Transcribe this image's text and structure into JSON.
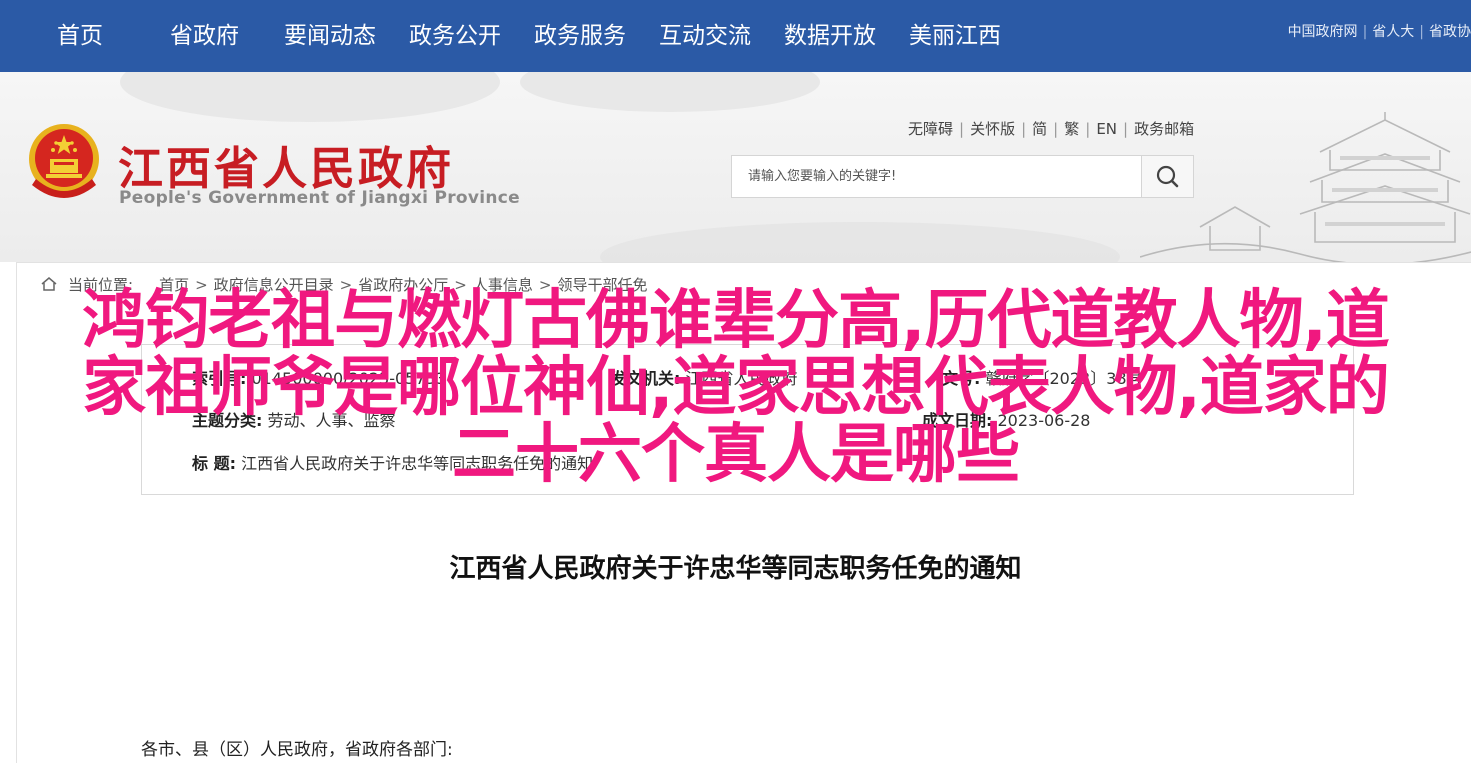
{
  "nav": {
    "items": [
      "首页",
      "省政府",
      "要闻动态",
      "政务公开",
      "政务服务",
      "互动交流",
      "数据开放",
      "美丽江西"
    ],
    "top_links": [
      "中国政府网",
      "省人大",
      "省政协"
    ]
  },
  "header": {
    "site_title": "江西省人民政府",
    "site_subtitle": "People's Government of Jiangxi Province",
    "utility_links": [
      "无障碍",
      "关怀版",
      "简",
      "繁",
      "EN",
      "政务邮箱"
    ],
    "search_placeholder": "请输入您要输入的关键字!"
  },
  "breadcrumb": {
    "label": "当前位置:",
    "items": [
      "首页",
      "政府信息公开目录",
      "省政府办公厅",
      "人事信息",
      "领导干部任免"
    ]
  },
  "info": {
    "index_label": "索引号:",
    "index_value": "014500000/2023-05733",
    "issuer_label": "发文机关:",
    "issuer_value": "江西省人民政府",
    "doc_no_label": "文号:",
    "doc_no_value": "赣府字〔2023〕38号",
    "category_label": "主题分类:",
    "category_value": "劳动、人事、监察",
    "date_label": "成文日期:",
    "date_value": "2023-06-28",
    "title_label": "标 题:",
    "title_value": "江西省人民政府关于许忠华等同志职务任免的通知"
  },
  "document": {
    "title": "江西省人民政府关于许忠华等同志职务任免的通知",
    "salutation": "各市、县（区）人民政府，省政府各部门:"
  },
  "overlay": {
    "lines": [
      "鸿钧老祖与燃灯古佛谁辈分高,历代道教人物,道",
      "家祖师爷是哪位神仙,道家思想代表人物,道家的",
      "二十六个真人是哪些"
    ]
  },
  "colors": {
    "nav_bg": "#2b5aa6",
    "brand_red": "#c71d23",
    "overlay_pink": "#f0187f"
  }
}
